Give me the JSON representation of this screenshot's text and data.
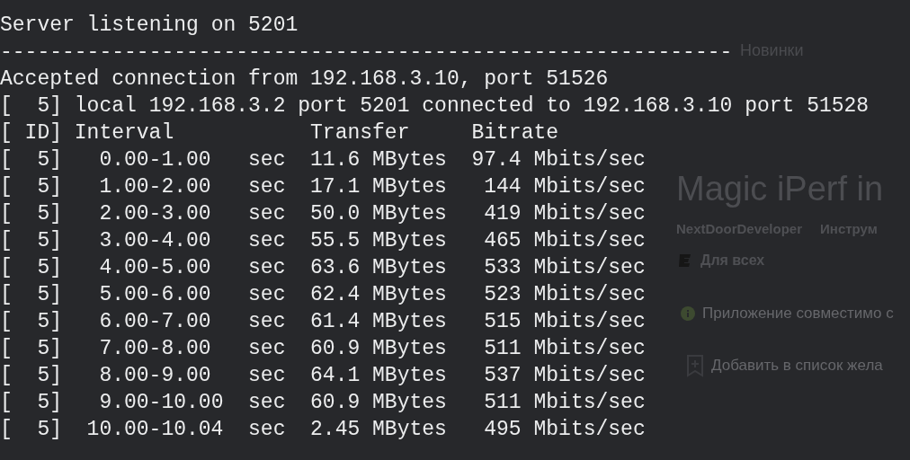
{
  "terminal": {
    "lines": [
      {
        "kind": "text",
        "text": "Server listening on 5201"
      },
      {
        "kind": "text",
        "text": "-----------------------------------------------------------"
      },
      {
        "kind": "text",
        "text": "Accepted connection from 192.168.3.10, port 51526"
      },
      {
        "kind": "text",
        "text": "[  5] local 192.168.3.2 port 5201 connected to 192.168.3.10 port 51528"
      },
      {
        "kind": "header",
        "id": "[ ID]",
        "interval": "Interval",
        "transfer": "Transfer",
        "bitrate": "Bitrate"
      },
      {
        "kind": "row",
        "id": "[  5]",
        "interval": "0.00-1.00",
        "interval_unit": "sec",
        "transfer": "11.6",
        "transfer_unit": "MBytes",
        "bitrate": "97.4",
        "bitrate_unit": "Mbits/sec"
      },
      {
        "kind": "row",
        "id": "[  5]",
        "interval": "1.00-2.00",
        "interval_unit": "sec",
        "transfer": "17.1",
        "transfer_unit": "MBytes",
        "bitrate": "144",
        "bitrate_unit": "Mbits/sec"
      },
      {
        "kind": "row",
        "id": "[  5]",
        "interval": "2.00-3.00",
        "interval_unit": "sec",
        "transfer": "50.0",
        "transfer_unit": "MBytes",
        "bitrate": "419",
        "bitrate_unit": "Mbits/sec"
      },
      {
        "kind": "row",
        "id": "[  5]",
        "interval": "3.00-4.00",
        "interval_unit": "sec",
        "transfer": "55.5",
        "transfer_unit": "MBytes",
        "bitrate": "465",
        "bitrate_unit": "Mbits/sec"
      },
      {
        "kind": "row",
        "id": "[  5]",
        "interval": "4.00-5.00",
        "interval_unit": "sec",
        "transfer": "63.6",
        "transfer_unit": "MBytes",
        "bitrate": "533",
        "bitrate_unit": "Mbits/sec"
      },
      {
        "kind": "row",
        "id": "[  5]",
        "interval": "5.00-6.00",
        "interval_unit": "sec",
        "transfer": "62.4",
        "transfer_unit": "MBytes",
        "bitrate": "523",
        "bitrate_unit": "Mbits/sec"
      },
      {
        "kind": "row",
        "id": "[  5]",
        "interval": "6.00-7.00",
        "interval_unit": "sec",
        "transfer": "61.4",
        "transfer_unit": "MBytes",
        "bitrate": "515",
        "bitrate_unit": "Mbits/sec"
      },
      {
        "kind": "row",
        "id": "[  5]",
        "interval": "7.00-8.00",
        "interval_unit": "sec",
        "transfer": "60.9",
        "transfer_unit": "MBytes",
        "bitrate": "511",
        "bitrate_unit": "Mbits/sec"
      },
      {
        "kind": "row",
        "id": "[  5]",
        "interval": "8.00-9.00",
        "interval_unit": "sec",
        "transfer": "64.1",
        "transfer_unit": "MBytes",
        "bitrate": "537",
        "bitrate_unit": "Mbits/sec"
      },
      {
        "kind": "row",
        "id": "[  5]",
        "interval": "9.00-10.00",
        "interval_unit": "sec",
        "transfer": "60.9",
        "transfer_unit": "MBytes",
        "bitrate": "511",
        "bitrate_unit": "Mbits/sec"
      },
      {
        "kind": "row",
        "id": "[  5]",
        "interval": "10.00-10.04",
        "interval_unit": "sec",
        "transfer": "2.45",
        "transfer_unit": "MBytes",
        "bitrate": "495",
        "bitrate_unit": "Mbits/sec"
      }
    ]
  },
  "store_page": {
    "tab": "Новинки",
    "app_title": "Magic iPerf in",
    "developer": "NextDoorDeveloper",
    "category": "Инструм",
    "rating": "Для всех",
    "compatibility": "Приложение совместимо с",
    "wishlist": "Добавить в список жела"
  }
}
